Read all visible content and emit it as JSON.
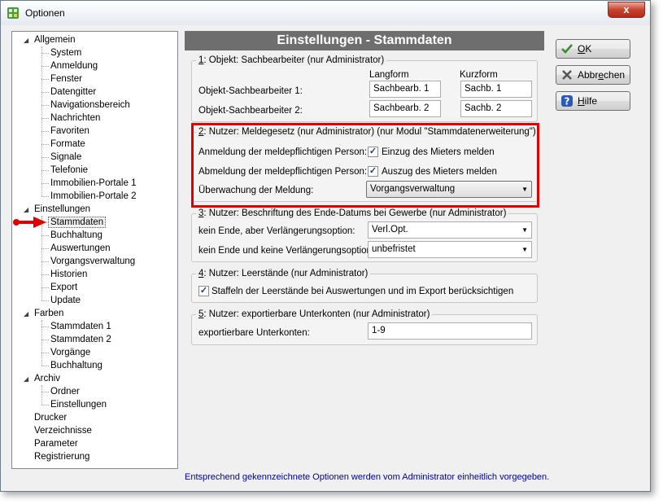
{
  "window": {
    "title": "Optionen",
    "close_symbol": "x",
    "app_icon": "options-app-icon"
  },
  "tree": {
    "nodes": [
      {
        "label": "Allgemein",
        "level": 0,
        "expanded": true
      },
      {
        "label": "System",
        "level": 1
      },
      {
        "label": "Anmeldung",
        "level": 1
      },
      {
        "label": "Fenster",
        "level": 1
      },
      {
        "label": "Datengitter",
        "level": 1
      },
      {
        "label": "Navigationsbereich",
        "level": 1
      },
      {
        "label": "Nachrichten",
        "level": 1
      },
      {
        "label": "Favoriten",
        "level": 1
      },
      {
        "label": "Formate",
        "level": 1
      },
      {
        "label": "Signale",
        "level": 1
      },
      {
        "label": "Telefonie",
        "level": 1
      },
      {
        "label": "Immobilien-Portale 1",
        "level": 1
      },
      {
        "label": "Immobilien-Portale 2",
        "level": 1
      },
      {
        "label": "Einstellungen",
        "level": 0,
        "expanded": true
      },
      {
        "label": "Stammdaten",
        "level": 1,
        "selected": true
      },
      {
        "label": "Buchhaltung",
        "level": 1
      },
      {
        "label": "Auswertungen",
        "level": 1
      },
      {
        "label": "Vorgangsverwaltung",
        "level": 1
      },
      {
        "label": "Historien",
        "level": 1
      },
      {
        "label": "Export",
        "level": 1
      },
      {
        "label": "Update",
        "level": 1
      },
      {
        "label": "Farben",
        "level": 0,
        "expanded": true
      },
      {
        "label": "Stammdaten 1",
        "level": 1
      },
      {
        "label": "Stammdaten 2",
        "level": 1
      },
      {
        "label": "Vorgänge",
        "level": 1
      },
      {
        "label": "Buchhaltung",
        "level": 1
      },
      {
        "label": "Archiv",
        "level": 0,
        "expanded": true
      },
      {
        "label": "Ordner",
        "level": 1
      },
      {
        "label": "Einstellungen",
        "level": 1
      },
      {
        "label": "Drucker",
        "level": 0
      },
      {
        "label": "Verzeichnisse",
        "level": 0
      },
      {
        "label": "Parameter",
        "level": 0
      },
      {
        "label": "Registrierung",
        "level": 0
      }
    ]
  },
  "header": {
    "title": "Einstellungen - Stammdaten"
  },
  "group1": {
    "num": "1",
    "title": ": Objekt: Sachbearbeiter  (nur Administrator)",
    "col_long": "Langform",
    "col_short": "Kurzform",
    "rows": [
      {
        "label": "Objekt-Sachbearbeiter 1:",
        "long": "Sachbearb. 1",
        "short": "Sachb. 1"
      },
      {
        "label": "Objekt-Sachbearbeiter 2:",
        "long": "Sachbearb. 2",
        "short": "Sachb. 2"
      }
    ]
  },
  "group2": {
    "num": "2",
    "title": ": Nutzer: Meldegesetz  (nur Administrator) (nur Modul \"Stammdatenerweiterung\")",
    "row1_label": "Anmeldung der meldepflichtigen Person:",
    "row1_check": "Einzug des Mieters melden",
    "row2_label": "Abmeldung der meldepflichtigen Person:",
    "row2_check": "Auszug des Mieters melden",
    "row3_label": "Überwachung der Meldung:",
    "row3_value": "Vorgangsverwaltung",
    "check_mark": "✓"
  },
  "group3": {
    "num": "3",
    "title": ": Nutzer: Beschriftung des Ende-Datums bei Gewerbe  (nur Administrator)",
    "row1_label": "kein Ende, aber Verlängerungsoption:",
    "row1_value": "Verl.Opt.",
    "row2_label": "kein Ende und keine Verlängerungsoption:",
    "row2_value": "unbefristet"
  },
  "group4": {
    "num": "4",
    "title": ": Nutzer: Leerstände  (nur Administrator)",
    "check_label": "Staffeln der Leerstände bei Auswertungen und im Export berücksichtigen"
  },
  "group5": {
    "num": "5",
    "title": ": Nutzer: exportierbare Unterkonten  (nur Administrator)",
    "label": "exportierbare Unterkonten:",
    "value": "1-9"
  },
  "footer": {
    "text": "Entsprechend gekennzeichnete Optionen werden vom Administrator einheitlich vorgegeben."
  },
  "buttons": {
    "ok": {
      "pre": "",
      "u": "O",
      "post": "K"
    },
    "cancel": {
      "pre": "Abbr",
      "u": "e",
      "post": "chen"
    },
    "help": {
      "pre": "",
      "u": "H",
      "post": "ilfe"
    }
  },
  "icons": {
    "ok": "checkmark-icon",
    "cancel": "cross-icon",
    "help": "question-mark-icon",
    "expanded": "triangle-expanded-icon",
    "combo": "chevron-down-icon",
    "pointer": "red-arrow-icon"
  },
  "colors": {
    "highlight": "#e00000",
    "header_bg": "#6e6e6e",
    "footer_text": "#0000a0"
  }
}
